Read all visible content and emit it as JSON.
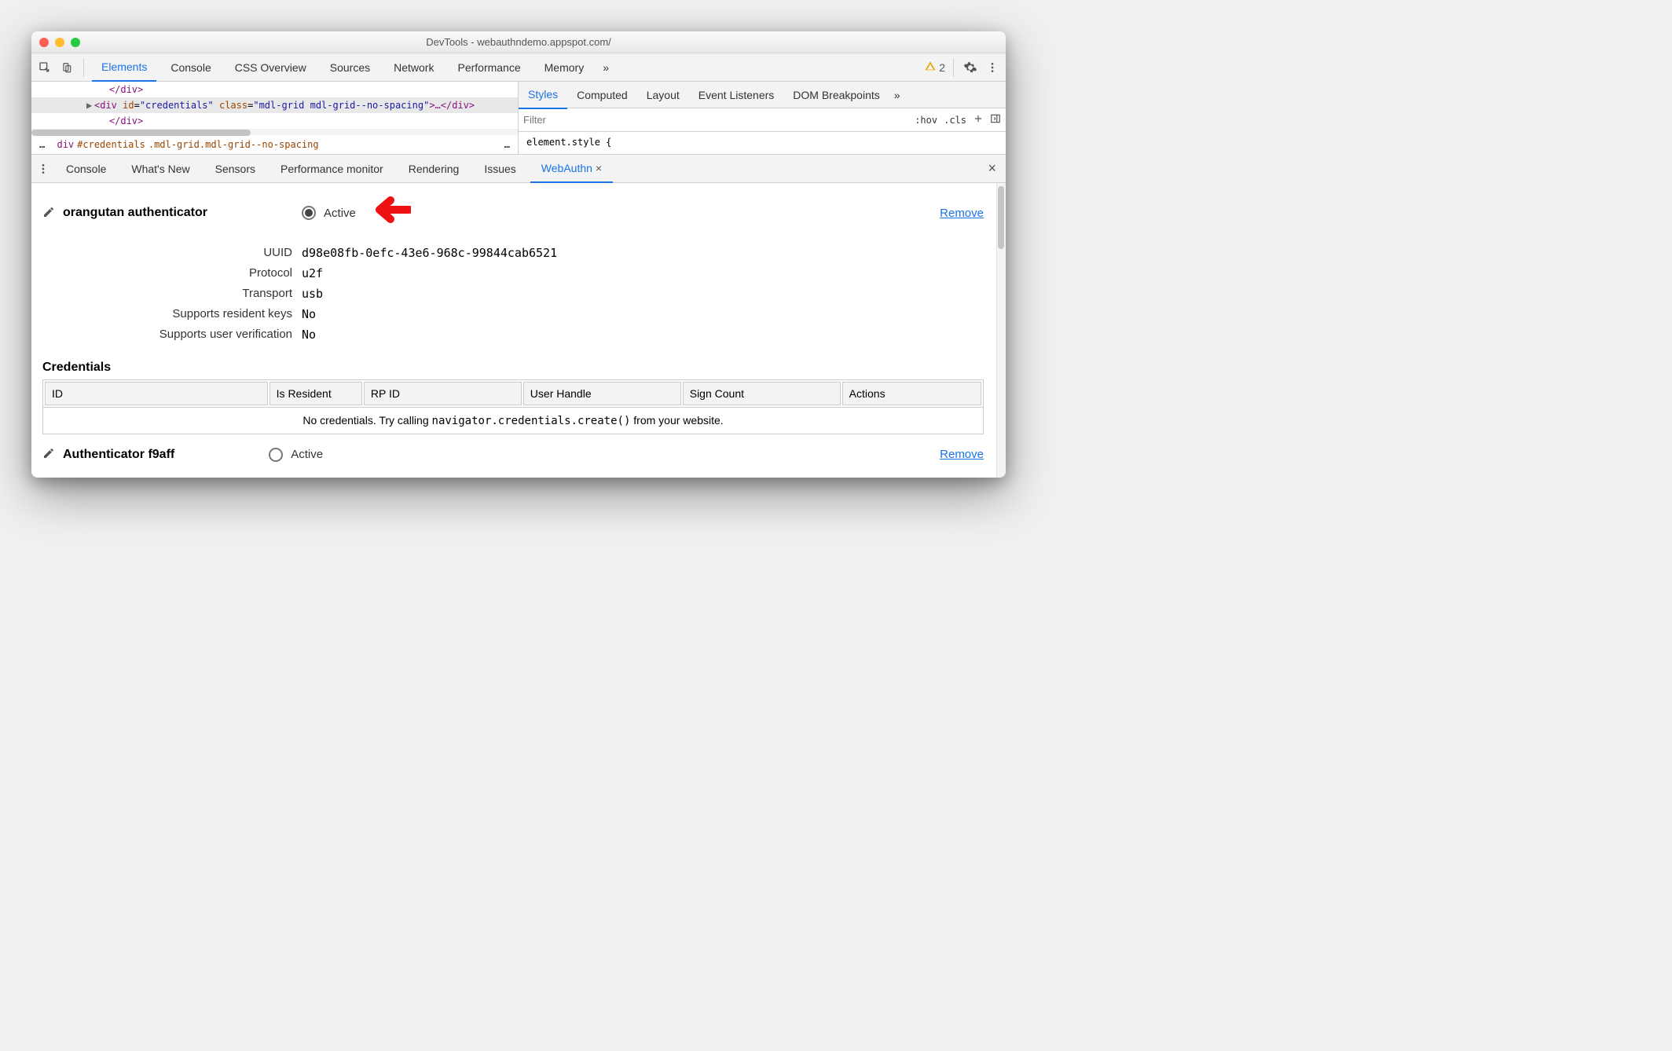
{
  "window": {
    "title": "DevTools - webauthndemo.appspot.com/"
  },
  "main_tabs": {
    "elements": "Elements",
    "console": "Console",
    "cssoverview": "CSS Overview",
    "sources": "Sources",
    "network": "Network",
    "performance": "Performance",
    "memory": "Memory",
    "more": "»"
  },
  "warn_count": "2",
  "dom": {
    "line0": "</div>",
    "line1_open": "<div",
    "line1_id_attr": "id",
    "line1_id_val": "\"credentials\"",
    "line1_class_attr": "class",
    "line1_class_val": "\"mdl-grid mdl-grid--no-spacing\"",
    "line1_mid": ">…",
    "line1_close": "</div>",
    "line2": "</div>"
  },
  "breadcrumb": {
    "left_ell": "…",
    "tag": "div",
    "id": "#credentials",
    "classes": ".mdl-grid.mdl-grid--no-spacing",
    "right_ell": "…"
  },
  "styles_tabs": {
    "styles": "Styles",
    "computed": "Computed",
    "layout": "Layout",
    "event_listeners": "Event Listeners",
    "dom_breakpoints": "DOM Breakpoints",
    "more": "»"
  },
  "filter_placeholder": "Filter",
  "hov": ":hov",
  "cls": ".cls",
  "element_style_text": "element.style {",
  "drawer_tabs": {
    "console": "Console",
    "whatsnew": "What's New",
    "sensors": "Sensors",
    "perfmon": "Performance monitor",
    "rendering": "Rendering",
    "issues": "Issues",
    "webauthn": "WebAuthn"
  },
  "authenticators": [
    {
      "name": "orangutan authenticator",
      "active": true,
      "active_label": "Active",
      "remove": "Remove",
      "fields": {
        "uuid_k": "UUID",
        "uuid_v": "d98e08fb-0efc-43e6-968c-99844cab6521",
        "protocol_k": "Protocol",
        "protocol_v": "u2f",
        "transport_k": "Transport",
        "transport_v": "usb",
        "srk_k": "Supports resident keys",
        "srk_v": "No",
        "suv_k": "Supports user verification",
        "suv_v": "No"
      }
    },
    {
      "name": "Authenticator f9aff",
      "active": false,
      "active_label": "Active",
      "remove": "Remove"
    }
  ],
  "credentials": {
    "heading": "Credentials",
    "cols": {
      "id": "ID",
      "resident": "Is Resident",
      "rpid": "RP ID",
      "uh": "User Handle",
      "sc": "Sign Count",
      "actions": "Actions"
    },
    "empty_pre": "No credentials. Try calling ",
    "empty_code": "navigator.credentials.create()",
    "empty_post": " from your website."
  }
}
